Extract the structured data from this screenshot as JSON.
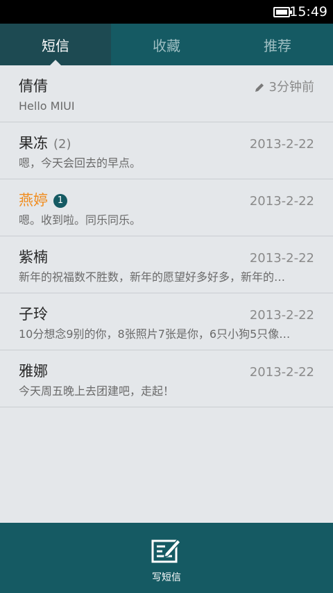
{
  "status": {
    "time": "15:49",
    "battery_level": 1.0
  },
  "tabs": [
    {
      "label": "短信",
      "active": true
    },
    {
      "label": "收藏",
      "active": false
    },
    {
      "label": "推荐",
      "active": false
    }
  ],
  "messages": [
    {
      "name": "倩倩",
      "count": "",
      "badge": "",
      "date": "3分钟前",
      "preview": "Hello MIUI",
      "draft": true,
      "unread": false
    },
    {
      "name": "果冻",
      "count": "(2)",
      "badge": "",
      "date": "2013-2-22",
      "preview": "嗯，今天会回去的早点。",
      "draft": false,
      "unread": false
    },
    {
      "name": "燕婷",
      "count": "",
      "badge": "1",
      "date": "2013-2-22",
      "preview": "嗯。收到啦。同乐同乐。",
      "draft": false,
      "unread": true
    },
    {
      "name": "紫楠",
      "count": "",
      "badge": "",
      "date": "2013-2-22",
      "preview": "新年的祝福数不胜数，新年的愿望好多好多，新年的…",
      "draft": false,
      "unread": false
    },
    {
      "name": "子玲",
      "count": "",
      "badge": "",
      "date": "2013-2-22",
      "preview": "10分想念9别的你，8张照片7张是你，6只小狗5只像…",
      "draft": false,
      "unread": false
    },
    {
      "name": "雅娜",
      "count": "",
      "badge": "",
      "date": "2013-2-22",
      "preview": "今天周五晚上去团建吧，走起！",
      "draft": false,
      "unread": false
    }
  ],
  "bottom": {
    "compose_label": "写短信",
    "compose_icon": "compose-icon"
  },
  "colors": {
    "header": "#155a63",
    "active_tab": "#1d4a52",
    "unread_name": "#f08c1e",
    "background": "#e4e7ea"
  }
}
